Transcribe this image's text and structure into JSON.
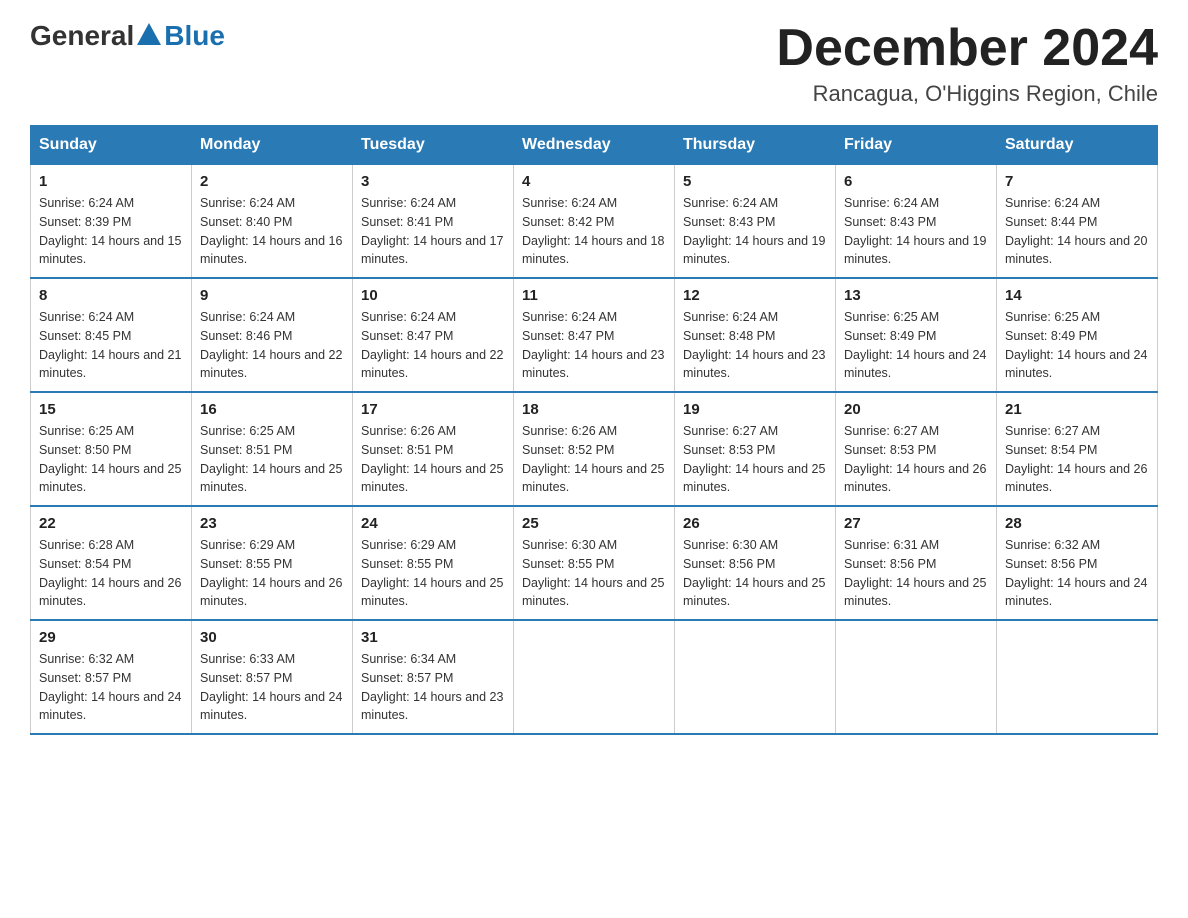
{
  "logo": {
    "general": "General",
    "blue": "Blue"
  },
  "header": {
    "month": "December 2024",
    "location": "Rancagua, O'Higgins Region, Chile"
  },
  "weekdays": [
    "Sunday",
    "Monday",
    "Tuesday",
    "Wednesday",
    "Thursday",
    "Friday",
    "Saturday"
  ],
  "weeks": [
    [
      {
        "day": "1",
        "sunrise": "Sunrise: 6:24 AM",
        "sunset": "Sunset: 8:39 PM",
        "daylight": "Daylight: 14 hours and 15 minutes."
      },
      {
        "day": "2",
        "sunrise": "Sunrise: 6:24 AM",
        "sunset": "Sunset: 8:40 PM",
        "daylight": "Daylight: 14 hours and 16 minutes."
      },
      {
        "day": "3",
        "sunrise": "Sunrise: 6:24 AM",
        "sunset": "Sunset: 8:41 PM",
        "daylight": "Daylight: 14 hours and 17 minutes."
      },
      {
        "day": "4",
        "sunrise": "Sunrise: 6:24 AM",
        "sunset": "Sunset: 8:42 PM",
        "daylight": "Daylight: 14 hours and 18 minutes."
      },
      {
        "day": "5",
        "sunrise": "Sunrise: 6:24 AM",
        "sunset": "Sunset: 8:43 PM",
        "daylight": "Daylight: 14 hours and 19 minutes."
      },
      {
        "day": "6",
        "sunrise": "Sunrise: 6:24 AM",
        "sunset": "Sunset: 8:43 PM",
        "daylight": "Daylight: 14 hours and 19 minutes."
      },
      {
        "day": "7",
        "sunrise": "Sunrise: 6:24 AM",
        "sunset": "Sunset: 8:44 PM",
        "daylight": "Daylight: 14 hours and 20 minutes."
      }
    ],
    [
      {
        "day": "8",
        "sunrise": "Sunrise: 6:24 AM",
        "sunset": "Sunset: 8:45 PM",
        "daylight": "Daylight: 14 hours and 21 minutes."
      },
      {
        "day": "9",
        "sunrise": "Sunrise: 6:24 AM",
        "sunset": "Sunset: 8:46 PM",
        "daylight": "Daylight: 14 hours and 22 minutes."
      },
      {
        "day": "10",
        "sunrise": "Sunrise: 6:24 AM",
        "sunset": "Sunset: 8:47 PM",
        "daylight": "Daylight: 14 hours and 22 minutes."
      },
      {
        "day": "11",
        "sunrise": "Sunrise: 6:24 AM",
        "sunset": "Sunset: 8:47 PM",
        "daylight": "Daylight: 14 hours and 23 minutes."
      },
      {
        "day": "12",
        "sunrise": "Sunrise: 6:24 AM",
        "sunset": "Sunset: 8:48 PM",
        "daylight": "Daylight: 14 hours and 23 minutes."
      },
      {
        "day": "13",
        "sunrise": "Sunrise: 6:25 AM",
        "sunset": "Sunset: 8:49 PM",
        "daylight": "Daylight: 14 hours and 24 minutes."
      },
      {
        "day": "14",
        "sunrise": "Sunrise: 6:25 AM",
        "sunset": "Sunset: 8:49 PM",
        "daylight": "Daylight: 14 hours and 24 minutes."
      }
    ],
    [
      {
        "day": "15",
        "sunrise": "Sunrise: 6:25 AM",
        "sunset": "Sunset: 8:50 PM",
        "daylight": "Daylight: 14 hours and 25 minutes."
      },
      {
        "day": "16",
        "sunrise": "Sunrise: 6:25 AM",
        "sunset": "Sunset: 8:51 PM",
        "daylight": "Daylight: 14 hours and 25 minutes."
      },
      {
        "day": "17",
        "sunrise": "Sunrise: 6:26 AM",
        "sunset": "Sunset: 8:51 PM",
        "daylight": "Daylight: 14 hours and 25 minutes."
      },
      {
        "day": "18",
        "sunrise": "Sunrise: 6:26 AM",
        "sunset": "Sunset: 8:52 PM",
        "daylight": "Daylight: 14 hours and 25 minutes."
      },
      {
        "day": "19",
        "sunrise": "Sunrise: 6:27 AM",
        "sunset": "Sunset: 8:53 PM",
        "daylight": "Daylight: 14 hours and 25 minutes."
      },
      {
        "day": "20",
        "sunrise": "Sunrise: 6:27 AM",
        "sunset": "Sunset: 8:53 PM",
        "daylight": "Daylight: 14 hours and 26 minutes."
      },
      {
        "day": "21",
        "sunrise": "Sunrise: 6:27 AM",
        "sunset": "Sunset: 8:54 PM",
        "daylight": "Daylight: 14 hours and 26 minutes."
      }
    ],
    [
      {
        "day": "22",
        "sunrise": "Sunrise: 6:28 AM",
        "sunset": "Sunset: 8:54 PM",
        "daylight": "Daylight: 14 hours and 26 minutes."
      },
      {
        "day": "23",
        "sunrise": "Sunrise: 6:29 AM",
        "sunset": "Sunset: 8:55 PM",
        "daylight": "Daylight: 14 hours and 26 minutes."
      },
      {
        "day": "24",
        "sunrise": "Sunrise: 6:29 AM",
        "sunset": "Sunset: 8:55 PM",
        "daylight": "Daylight: 14 hours and 25 minutes."
      },
      {
        "day": "25",
        "sunrise": "Sunrise: 6:30 AM",
        "sunset": "Sunset: 8:55 PM",
        "daylight": "Daylight: 14 hours and 25 minutes."
      },
      {
        "day": "26",
        "sunrise": "Sunrise: 6:30 AM",
        "sunset": "Sunset: 8:56 PM",
        "daylight": "Daylight: 14 hours and 25 minutes."
      },
      {
        "day": "27",
        "sunrise": "Sunrise: 6:31 AM",
        "sunset": "Sunset: 8:56 PM",
        "daylight": "Daylight: 14 hours and 25 minutes."
      },
      {
        "day": "28",
        "sunrise": "Sunrise: 6:32 AM",
        "sunset": "Sunset: 8:56 PM",
        "daylight": "Daylight: 14 hours and 24 minutes."
      }
    ],
    [
      {
        "day": "29",
        "sunrise": "Sunrise: 6:32 AM",
        "sunset": "Sunset: 8:57 PM",
        "daylight": "Daylight: 14 hours and 24 minutes."
      },
      {
        "day": "30",
        "sunrise": "Sunrise: 6:33 AM",
        "sunset": "Sunset: 8:57 PM",
        "daylight": "Daylight: 14 hours and 24 minutes."
      },
      {
        "day": "31",
        "sunrise": "Sunrise: 6:34 AM",
        "sunset": "Sunset: 8:57 PM",
        "daylight": "Daylight: 14 hours and 23 minutes."
      },
      null,
      null,
      null,
      null
    ]
  ]
}
